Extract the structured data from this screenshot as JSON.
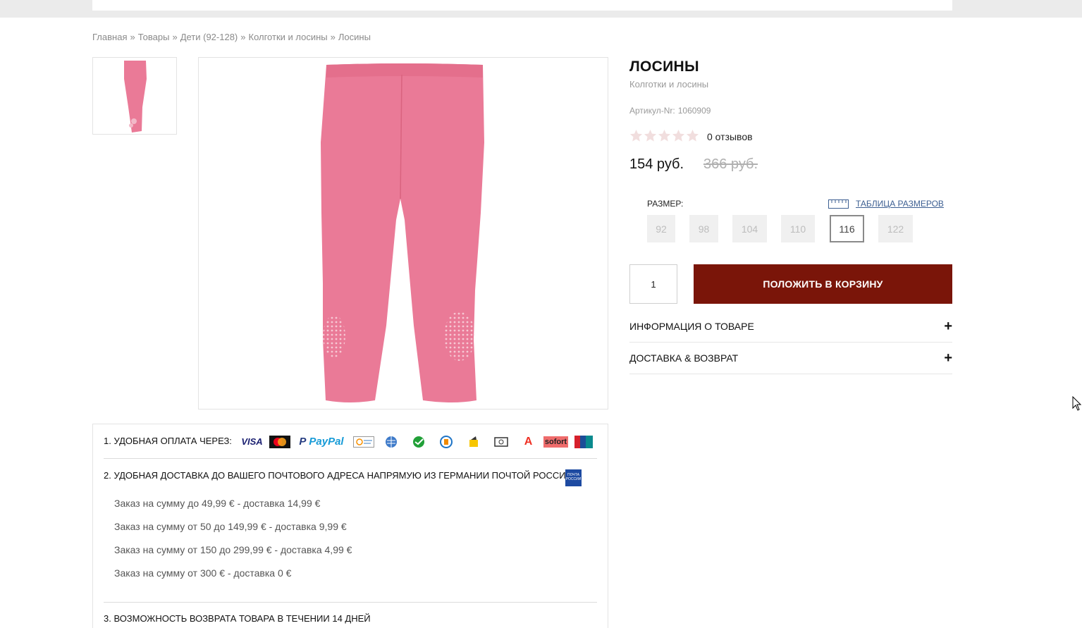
{
  "breadcrumb": [
    {
      "label": "Главная"
    },
    {
      "label": "Товары"
    },
    {
      "label": "Дети (92-128)"
    },
    {
      "label": "Колготки и лосины"
    },
    {
      "label": "Лосины"
    }
  ],
  "breadcrumb_separator": "»",
  "product": {
    "title": "ЛОСИНЫ",
    "category": "Колготки и лосины",
    "sku_label": "Артикул-Nr:",
    "sku_value": "1060909",
    "rating": 0,
    "reviews": "0 отзывов",
    "price": "154 руб.",
    "old_price": "366 руб.",
    "image_color": "#ea7a97"
  },
  "sizes": {
    "label": "РАЗМЕР:",
    "table_link": "ТАБЛИЦА РАЗМЕРОВ",
    "options": [
      {
        "label": "92",
        "selected": false
      },
      {
        "label": "98",
        "selected": false
      },
      {
        "label": "104",
        "selected": false
      },
      {
        "label": "110",
        "selected": false
      },
      {
        "label": "116",
        "selected": true
      },
      {
        "label": "122",
        "selected": false
      }
    ]
  },
  "cart": {
    "quantity": "1",
    "button_label": "ПОЛОЖИТЬ В КОРЗИНУ",
    "button_color": "#7a1509"
  },
  "accordion": [
    {
      "label": "ИНФОРМАЦИЯ О ТОВАРЕ",
      "icon": "+"
    },
    {
      "label": "ДОСТАВКА & ВОЗВРАТ",
      "icon": "+"
    }
  ],
  "info": {
    "payment": "1. УДОБНАЯ ОПЛАТА ЧЕРЕЗ:",
    "payment_icons": [
      "VISA",
      "mastercard",
      "PayPal",
      "qiwi",
      "webmoney",
      "sberbank",
      "paykeeper",
      "yandex-money",
      "cash",
      "alfa-bank",
      "sofort",
      "unionpay"
    ],
    "delivery": "2. УДОБНАЯ ДОСТАВКА ДО ВАШЕГО ПОЧТОВОГО АДРЕСА НАПРЯМУЮ ИЗ ГЕРМАНИИ ПОЧТОЙ РОССИИ:",
    "post_logo_text": "ПОЧТА РОССИИ",
    "shipping": [
      "Заказ на сумму до 49,99 € - доставка 14,99 €",
      "Заказ на сумму от 50 до 149,99 € - доставка 9,99 €",
      "Заказ на сумму от 150 до 299,99 € - доставка 4,99 €",
      "Заказ на сумму от 300 € - доставка 0 €"
    ],
    "returns": "3. ВОЗМОЖНОСТЬ ВОЗВРАТА ТОВАРА В ТЕЧЕНИИ 14 ДНЕЙ"
  }
}
